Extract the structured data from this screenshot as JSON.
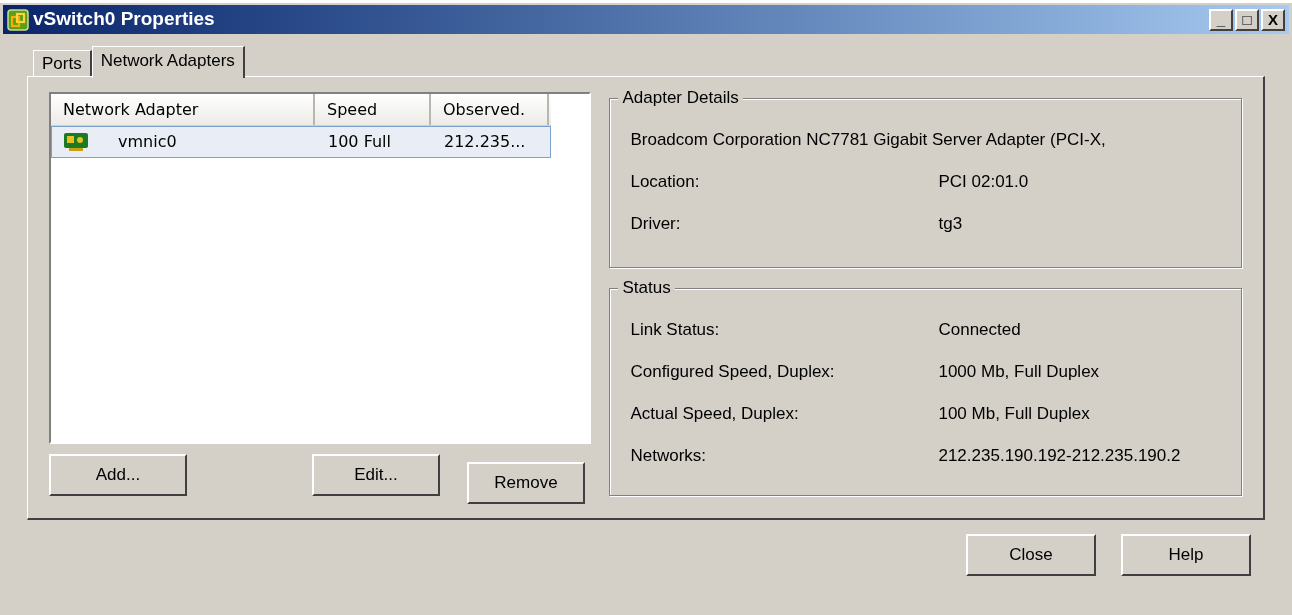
{
  "window": {
    "title": "vSwitch0 Properties",
    "controls": [
      "_",
      "□",
      "X"
    ]
  },
  "tabs": [
    {
      "label": "Ports",
      "selected": false
    },
    {
      "label": "Network Adapters",
      "selected": true
    }
  ],
  "table": {
    "columns": [
      "Network Adapter",
      "Speed",
      "Observed."
    ],
    "rows": [
      {
        "name": "vmnic0",
        "speed": "100 Full",
        "observed": "212.235...",
        "selected": true
      }
    ]
  },
  "list_buttons": [
    "Add...",
    "Edit...",
    "Remove"
  ],
  "adapter_details": {
    "title": "Adapter Details",
    "description": "Broadcom Corporation NC7781 Gigabit Server Adapter (PCI-X,",
    "fields": [
      {
        "label": "Location:",
        "value": "PCI 02:01.0"
      },
      {
        "label": "Driver:",
        "value": "tg3"
      }
    ]
  },
  "status": {
    "title": "Status",
    "fields": [
      {
        "label": "Link Status:",
        "value": "Connected"
      },
      {
        "label": "Configured Speed, Duplex:",
        "value": "1000 Mb, Full Duplex"
      },
      {
        "label": "Actual Speed, Duplex:",
        "value": "100 Mb, Full Duplex"
      },
      {
        "label": "Networks:",
        "value": "212.235.190.192-212.235.190.2"
      }
    ]
  },
  "buttons": [
    "Close",
    "Help"
  ]
}
